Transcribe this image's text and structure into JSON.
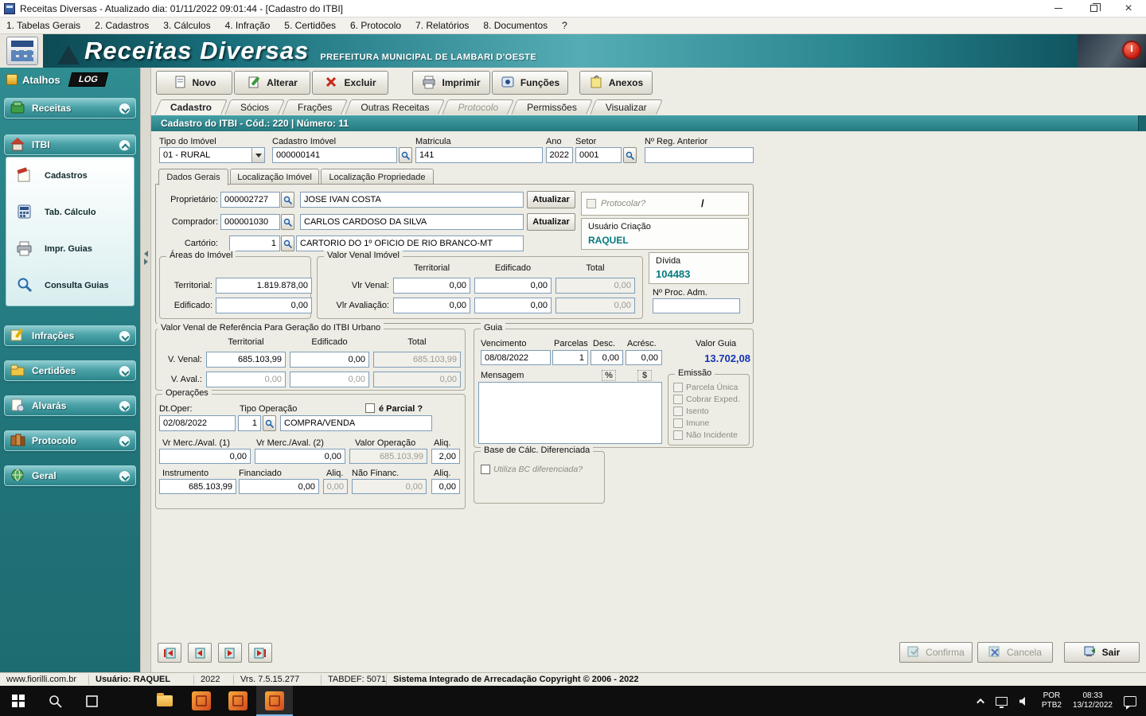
{
  "window_title": "Receitas Diversas - Atualizado dia: 01/11/2022 09:01:44 - [Cadastro do ITBI]",
  "icons": {
    "close": "×",
    "question": "?"
  },
  "menu_items": [
    "1. Tabelas Gerais",
    "2. Cadastros",
    "3. Cálculos",
    "4. Infração",
    "5. Certidões",
    "6. Protocolo",
    "7. Relatórios",
    "8. Documentos",
    "?"
  ],
  "banner": {
    "logo": "Receitas Diversas",
    "subtitle": "PREFEITURA MUNICIPAL DE LAMBARI D'OESTE"
  },
  "sidebar": {
    "header": "Atalhos",
    "badge": "LOG",
    "items": [
      {
        "label": "Receitas"
      },
      {
        "label": "ITBI"
      },
      {
        "label": "Infrações"
      },
      {
        "label": "Certidões"
      },
      {
        "label": "Alvarás"
      },
      {
        "label": "Protocolo"
      },
      {
        "label": "Geral"
      }
    ],
    "itbi_children": [
      "Cadastros",
      "Tab. Cálculo",
      "Impr. Guias",
      "Consulta Guias"
    ]
  },
  "toolbar": {
    "novo": "Novo",
    "alterar": "Alterar",
    "excluir": "Excluir",
    "imprimir": "Imprimir",
    "funcoes": "Funções",
    "anexos": "Anexos"
  },
  "tabs": [
    "Cadastro",
    "Sócios",
    "Frações",
    "Outras Receitas",
    "Protocolo",
    "Permissões",
    "Visualizar"
  ],
  "record_header": "Cadastro do ITBI - Cód.: 220 | Número:  11",
  "top_fields": {
    "tipo_label": "Tipo do Imóvel",
    "tipo": "01 - RURAL",
    "cad_label": "Cadastro Imóvel",
    "cad": "000000141",
    "mat_label": "Matricula",
    "mat": "141",
    "ano_label": "Ano",
    "ano": "2022",
    "setor_label": "Setor",
    "setor": "0001",
    "reg_label": "Nº Reg. Anterior",
    "reg": ""
  },
  "inner_tabs": [
    "Dados Gerais",
    "Localização Imóvel",
    "Localização Propriedade"
  ],
  "dados": {
    "proprietario_label": "Proprietário:",
    "proprietario_code": "000002727",
    "proprietario_name": "JOSE IVAN COSTA",
    "atualizar": "Atualizar",
    "comprador_label": "Comprador:",
    "comprador_code": "000001030",
    "comprador_name": "CARLOS CARDOSO DA SILVA",
    "cartorio_label": "Cartório:",
    "cartorio_code": "1",
    "cartorio_name": "CARTORIO DO 1º OFICIO DE RIO BRANCO-MT",
    "protocolar": "Protocolar?",
    "barra": "/",
    "usuario_criacao_label": "Usuário Criação",
    "usuario_criacao": "RAQUEL",
    "divida_label": "Dívida",
    "divida": "104483",
    "proc_adm_label": "Nº Proc. Adm.",
    "proc_adm": ""
  },
  "areas": {
    "title": "Áreas do Imóvel",
    "territorial_label": "Territorial:",
    "territorial": "1.819.878,00",
    "edificado_label": "Edificado:",
    "edificado": "0,00"
  },
  "vvi": {
    "title": "Valor Venal Imóvel",
    "cols": [
      "Territorial",
      "Edificado",
      "Total"
    ],
    "venal_label": "Vlr Venal:",
    "venal": [
      "0,00",
      "0,00",
      "0,00"
    ],
    "aval_label": "Vlr Avaliação:",
    "aval": [
      "0,00",
      "0,00",
      "0,00"
    ]
  },
  "ref": {
    "title": "Valor Venal de Referência Para Geração do ITBI Urbano",
    "cols": [
      "Territorial",
      "Edificado",
      "Total"
    ],
    "venal_label": "V. Venal:",
    "venal": [
      "685.103,99",
      "0,00",
      "685.103,99"
    ],
    "aval_label": "V. Aval.:",
    "aval": [
      "0,00",
      "0,00",
      "0,00"
    ]
  },
  "guia": {
    "title": "Guia",
    "vencimento_label": "Vencimento",
    "vencimento": "08/08/2022",
    "parcelas_label": "Parcelas",
    "parcelas": "1",
    "desc_label": "Desc.",
    "desc": "0,00",
    "acresc_label": "Acrésc.",
    "acresc": "0,00",
    "valor_label": "Valor Guia",
    "valor": "13.702,08",
    "mensagem_label": "Mensagem",
    "mensagem": "",
    "percent": "%",
    "cifrao": "$",
    "emissao_title": "Emissão",
    "emissao": [
      "Parcela Única",
      "Cobrar Exped.",
      "Isento",
      "Imune",
      "Não Incidente"
    ]
  },
  "oper": {
    "title": "Operações",
    "dt_label": "Dt.Oper:",
    "dt": "02/08/2022",
    "tipo_label": "Tipo Operação",
    "tipo_code": "1",
    "tipo_nome": "COMPRA/VENDA",
    "parcial": "é Parcial ?",
    "vm1_label": "Vr Merc./Aval. (1)",
    "vm1": "0,00",
    "vm2_label": "Vr Merc./Aval. (2)",
    "vm2": "0,00",
    "vop_label": "Valor Operação",
    "vop": "685.103,99",
    "aliq1_label": "Aliq.",
    "aliq1": "2,00",
    "instr_label": "Instrumento",
    "instr": "685.103,99",
    "fin_label": "Financiado",
    "fin": "0,00",
    "aliq2_label": "Aliq.",
    "aliq2": "0,00",
    "nfin_label": "Não Financ.",
    "nfin": "0,00",
    "aliq3_label": "Aliq.",
    "aliq3": "0,00"
  },
  "bc": {
    "title": "Base de Cálc. Diferenciada",
    "label": "Utiliza BC diferenciada?"
  },
  "footer": {
    "confirma": "Confirma",
    "cancela": "Cancela",
    "sair": "Sair"
  },
  "statusbar": {
    "site": "www.fiorilli.com.br",
    "usuario": "Usuário: RAQUEL",
    "ano": "2022",
    "versao": "Vrs. 7.5.15.277",
    "tabdef": "TABDEF: 5071",
    "copyright": "Sistema Integrado de Arrecadação Copyright © 2006 - 2022"
  },
  "taskbar": {
    "lang1": "POR",
    "lang2": "PTB2",
    "time": "08:33",
    "date": "13/12/2022"
  }
}
